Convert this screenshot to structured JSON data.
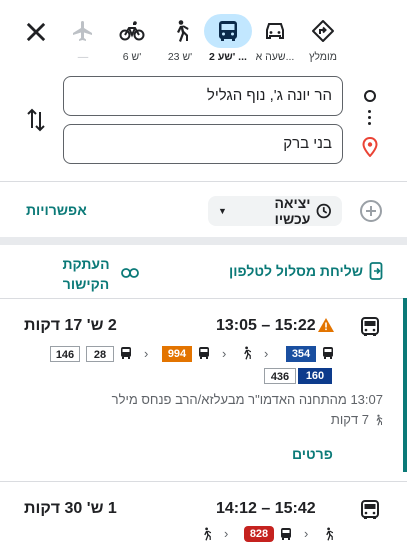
{
  "modes": [
    {
      "name": "recommended",
      "label": "מומלץ",
      "active": false
    },
    {
      "name": "car",
      "label": "שעה א...",
      "active": false
    },
    {
      "name": "transit",
      "label": "2 שע' ...",
      "active": true
    },
    {
      "name": "walk",
      "label": "23 ש'",
      "active": false
    },
    {
      "name": "bike",
      "label": "6 ש'",
      "active": false
    },
    {
      "name": "flight",
      "label": "—",
      "active": false
    }
  ],
  "origin": "הר יונה ג', נוף הגליל",
  "destination": "בני ברק",
  "options_label": "אפשרויות",
  "depart_label": "יציאה עכשיו",
  "send_to_phone": "שליחת מסלול לטלפון",
  "copy_link": "העתקת הקישור",
  "route1": {
    "time": "13:05 – 15:22",
    "duration": "2 ש' 17 דקות",
    "lines": [
      "994",
      "28",
      "146",
      "354",
      "436",
      "160"
    ],
    "description": "13:07 מהתחנה האדמו\"ר מבעלזא/הרב פנחס מילר",
    "walk": "7 דקות",
    "details": "פרטים"
  },
  "route2": {
    "time": "14:12 – 15:42",
    "duration": "1 ש' 30 דקות",
    "lines": [
      "828"
    ]
  }
}
